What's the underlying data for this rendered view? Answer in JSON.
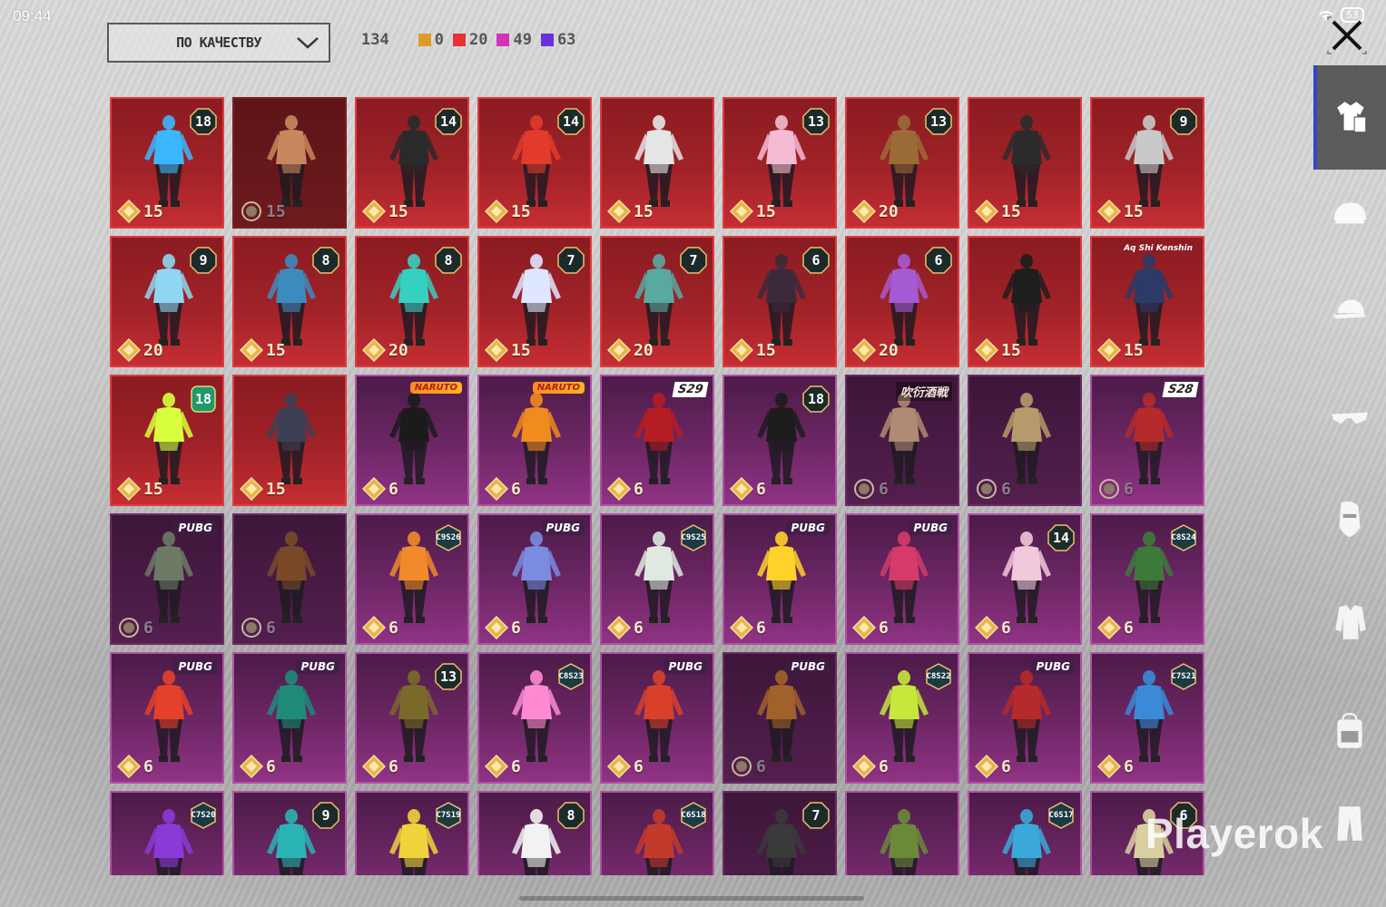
{
  "status": {
    "time": "09:44",
    "battery": "53"
  },
  "toolbar": {
    "sort_label": "ПО КАЧЕСТВУ",
    "total": "134",
    "counts": [
      {
        "value": "0",
        "color": "#e09a2a"
      },
      {
        "value": "20",
        "color": "#e83236"
      },
      {
        "value": "49",
        "color": "#cf35b9"
      },
      {
        "value": "63",
        "color": "#6a2fd8"
      }
    ]
  },
  "sidebar": {
    "items": [
      {
        "icon": "outfit-icon",
        "active": true
      },
      {
        "icon": "helmet-icon"
      },
      {
        "icon": "cap-icon"
      },
      {
        "icon": "sunglasses-icon"
      },
      {
        "icon": "mask-icon"
      },
      {
        "icon": "jacket-icon"
      },
      {
        "icon": "backpack-icon"
      },
      {
        "icon": "pants-icon"
      }
    ]
  },
  "watermark": "Playerok",
  "items": [
    {
      "rarity": "red",
      "badge": "18",
      "price": "15",
      "hue": "#3bb7ff"
    },
    {
      "rarity": "red-dark",
      "badge": "",
      "price": "15",
      "hue": "#c9875e",
      "muted": true
    },
    {
      "rarity": "red",
      "badge": "14",
      "price": "15",
      "hue": "#2a2a2a"
    },
    {
      "rarity": "red",
      "badge": "14",
      "price": "15",
      "hue": "#e23b2b"
    },
    {
      "rarity": "red",
      "badge": "",
      "price": "15",
      "hue": "#e5e5e5"
    },
    {
      "rarity": "red",
      "badge": "13",
      "price": "15",
      "hue": "#f3bcd2"
    },
    {
      "rarity": "red",
      "badge": "13",
      "price": "20",
      "hue": "#9a6b36"
    },
    {
      "rarity": "red",
      "badge": "",
      "price": "15",
      "hue": "#2b2b2b"
    },
    {
      "rarity": "red",
      "badge": "9",
      "price": "15",
      "hue": "#c9c9c9"
    },
    {
      "rarity": "red",
      "badge": "9",
      "price": "20",
      "hue": "#8fd6f2"
    },
    {
      "rarity": "red",
      "badge": "8",
      "price": "15",
      "hue": "#3c8bbf"
    },
    {
      "rarity": "red",
      "badge": "8",
      "price": "20",
      "hue": "#36d0c2"
    },
    {
      "rarity": "red",
      "badge": "7",
      "price": "15",
      "hue": "#dfe6ff"
    },
    {
      "rarity": "red",
      "badge": "7",
      "price": "20",
      "hue": "#58a9a0"
    },
    {
      "rarity": "red",
      "badge": "6",
      "price": "15",
      "hue": "#3a2a3a"
    },
    {
      "rarity": "red",
      "badge": "6",
      "price": "20",
      "hue": "#a45ad2"
    },
    {
      "rarity": "red",
      "badge": "",
      "price": "15",
      "hue": "#1e1e1e"
    },
    {
      "rarity": "red",
      "badge": "",
      "price": "15",
      "hue": "#2b3a66",
      "tag": "Aq Shi Kenshin",
      "tagType": "hand"
    },
    {
      "rarity": "red",
      "badge": "18",
      "price": "15",
      "hue": "#d8ff3c",
      "badgeGreen": true
    },
    {
      "rarity": "red",
      "badge": "",
      "price": "15",
      "hue": "#3d3f55"
    },
    {
      "rarity": "purple",
      "badge": "",
      "price": "6",
      "hue": "#1b1b1b",
      "tag": "NARUTO",
      "tagType": "naruto"
    },
    {
      "rarity": "purple",
      "badge": "",
      "price": "6",
      "hue": "#f08b1e",
      "tag": "NARUTO",
      "tagType": "naruto"
    },
    {
      "rarity": "purple",
      "badge": "",
      "price": "6",
      "hue": "#b41d24",
      "tag": "S29",
      "tagType": "s"
    },
    {
      "rarity": "purple",
      "badge": "18",
      "price": "6",
      "hue": "#1c1c1c"
    },
    {
      "rarity": "purple-dark",
      "badge": "",
      "price": "6",
      "hue": "#b18a74",
      "tag": "吹衍酒戦",
      "tagType": "hiero",
      "muted": true
    },
    {
      "rarity": "purple-dark",
      "badge": "",
      "price": "6",
      "hue": "#b79a6b",
      "muted": true
    },
    {
      "rarity": "purple",
      "badge": "",
      "price": "6",
      "hue": "#b52a2a",
      "tag": "S28",
      "tagType": "s",
      "muted": true
    },
    {
      "rarity": "purple-dark",
      "badge": "",
      "price": "6",
      "hue": "#6d7a66",
      "tag": "PUBG",
      "tagType": "pubg",
      "muted": true
    },
    {
      "rarity": "purple-dark",
      "badge": "",
      "price": "6",
      "hue": "#7a4a28",
      "muted": true
    },
    {
      "rarity": "purple",
      "badge": "C9S26",
      "price": "6",
      "hue": "#f08a2a",
      "hex": true
    },
    {
      "rarity": "purple",
      "badge": "",
      "price": "6",
      "hue": "#7a8be0",
      "tag": "PUBG",
      "tagType": "pubg"
    },
    {
      "rarity": "purple",
      "badge": "C9S25",
      "price": "6",
      "hue": "#dfe9df",
      "hex": true
    },
    {
      "rarity": "purple",
      "badge": "",
      "price": "6",
      "hue": "#ffd22a",
      "tag": "PUBG",
      "tagType": "pubg"
    },
    {
      "rarity": "purple",
      "badge": "",
      "price": "6",
      "hue": "#d63a6a",
      "tag": "PUBG",
      "tagType": "pubg"
    },
    {
      "rarity": "purple",
      "badge": "14",
      "price": "6",
      "hue": "#f2c8dc"
    },
    {
      "rarity": "purple",
      "badge": "C8S24",
      "price": "6",
      "hue": "#3d7a3a",
      "hex": true
    },
    {
      "rarity": "purple",
      "badge": "",
      "price": "6",
      "hue": "#e5402a",
      "tag": "PUBG",
      "tagType": "pubg"
    },
    {
      "rarity": "purple",
      "badge": "",
      "price": "6",
      "hue": "#1f8a7a",
      "tag": "PUBG",
      "tagType": "pubg"
    },
    {
      "rarity": "purple",
      "badge": "13",
      "price": "6",
      "hue": "#7a6a2a"
    },
    {
      "rarity": "purple",
      "badge": "C8S23",
      "price": "6",
      "hue": "#ff8ad2",
      "hex": true
    },
    {
      "rarity": "purple",
      "badge": "",
      "price": "6",
      "hue": "#d8402a",
      "tag": "PUBG",
      "tagType": "pubg"
    },
    {
      "rarity": "purple-dark",
      "badge": "",
      "price": "6",
      "hue": "#a0622a",
      "tag": "PUBG",
      "tagType": "pubg",
      "muted": true
    },
    {
      "rarity": "purple",
      "badge": "C8S22",
      "price": "6",
      "hue": "#c6e83a",
      "hex": true
    },
    {
      "rarity": "purple",
      "badge": "",
      "price": "6",
      "hue": "#b52a2a",
      "tag": "PUBG",
      "tagType": "pubg"
    },
    {
      "rarity": "purple",
      "badge": "C7S21",
      "price": "6",
      "hue": "#3a8ad8",
      "hex": true
    },
    {
      "rarity": "purple",
      "badge": "C7S20",
      "price": "",
      "hue": "#8a3ad8",
      "hex": true
    },
    {
      "rarity": "purple",
      "badge": "9",
      "price": "",
      "hue": "#2ab3b3"
    },
    {
      "rarity": "purple",
      "badge": "C7S19",
      "price": "",
      "hue": "#f0d23a",
      "hex": true
    },
    {
      "rarity": "purple",
      "badge": "8",
      "price": "",
      "hue": "#f2f2f2"
    },
    {
      "rarity": "purple",
      "badge": "C6S18",
      "price": "",
      "hue": "#c23a2a",
      "hex": true
    },
    {
      "rarity": "purple-dark",
      "badge": "7",
      "price": "",
      "hue": "#3a3a3a"
    },
    {
      "rarity": "purple",
      "badge": "",
      "price": "",
      "hue": "#6a8a3a"
    },
    {
      "rarity": "purple",
      "badge": "C6S17",
      "price": "",
      "hue": "#3aa8d8",
      "hex": true
    },
    {
      "rarity": "purple",
      "badge": "6",
      "price": "",
      "hue": "#d8d0a0"
    }
  ]
}
